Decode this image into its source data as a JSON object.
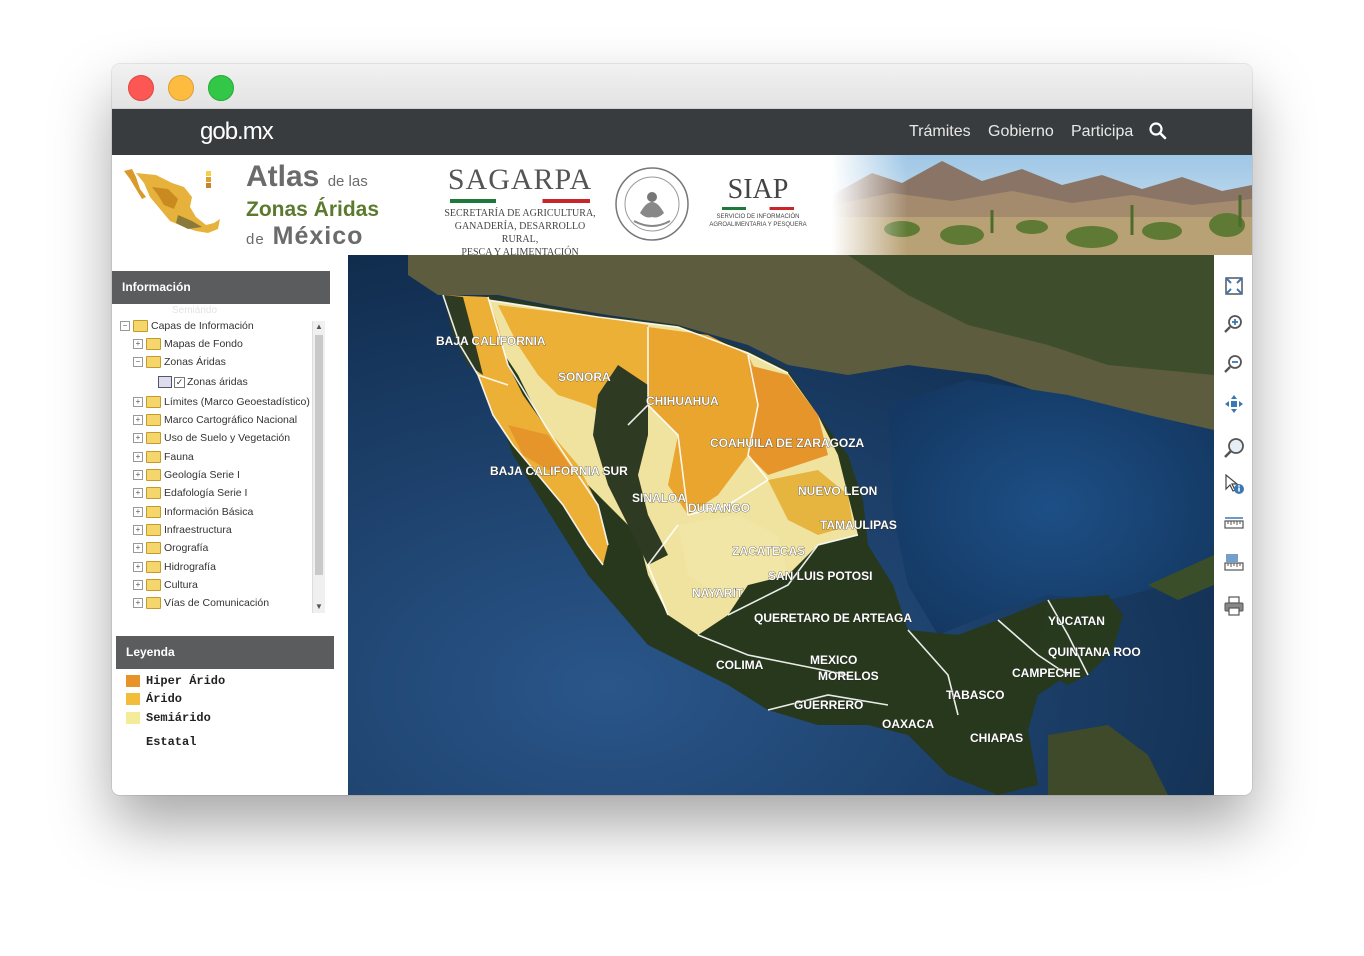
{
  "window": {
    "controls": [
      "close",
      "minimize",
      "zoom"
    ]
  },
  "gob_nav": {
    "logo": "gob.mx",
    "links": [
      "Trámites",
      "Gobierno",
      "Participa"
    ],
    "search_icon": "search-icon"
  },
  "header": {
    "atlas_title": {
      "l1_big": "Atlas",
      "l1_small": "de las",
      "l2": "Zonas Áridas",
      "l3_small": "de",
      "l3_big": "México"
    },
    "sagarpa": {
      "name": "SAGARPA",
      "subtitle": [
        "SECRETARÍA DE AGRICULTURA,",
        "GANADERÍA, DESARROLLO RURAL,",
        "PESCA Y ALIMENTACIÓN"
      ]
    },
    "siap": {
      "name": "SIAP",
      "subtitle": [
        "SERVICIO DE INFORMACIÓN",
        "AGROALIMENTARIA Y PESQUERA"
      ]
    }
  },
  "info_panel": {
    "title": "Información",
    "ghost_text": "Semiárido",
    "tree": [
      {
        "label": "Capas de Información",
        "level": 0,
        "expanded": true
      },
      {
        "label": "Mapas de Fondo",
        "level": 1,
        "expanded": false
      },
      {
        "label": "Zonas Áridas",
        "level": 1,
        "expanded": true
      },
      {
        "label": "Zonas áridas",
        "level": 2,
        "checked": true
      },
      {
        "label": "Límites (Marco Geoestadístico)",
        "level": 1
      },
      {
        "label": "Marco Cartográfico Nacional",
        "level": 1
      },
      {
        "label": "Uso de Suelo y Vegetación",
        "level": 1
      },
      {
        "label": "Fauna",
        "level": 1
      },
      {
        "label": "Geología Serie I",
        "level": 1
      },
      {
        "label": "Edafología Serie I",
        "level": 1
      },
      {
        "label": "Información Básica",
        "level": 1
      },
      {
        "label": "Infraestructura",
        "level": 1
      },
      {
        "label": "Orografía",
        "level": 1
      },
      {
        "label": "Hidrografía",
        "level": 1
      },
      {
        "label": "Cultura",
        "level": 1
      },
      {
        "label": "Vías de Comunicación",
        "level": 1
      }
    ]
  },
  "legend": {
    "title": "Leyenda",
    "items": [
      {
        "label": "Hiper Árido",
        "color": "#e8922a"
      },
      {
        "label": "Árido",
        "color": "#f2bd3a"
      },
      {
        "label": "Semiárido",
        "color": "#f5ec9a"
      },
      {
        "label": "Estatal",
        "color": "#ffffff"
      }
    ]
  },
  "map": {
    "state_labels": [
      "BAJA CALIFORNIA",
      "SONORA",
      "CHIHUAHUA",
      "COAHUILA DE ZARAGOZA",
      "BAJA CALIFORNIA SUR",
      "SINALOA",
      "DURANGO",
      "NUEVO LEON",
      "TAMAULIPAS",
      "ZACATECAS",
      "SAN LUIS POTOSI",
      "NAYARIT",
      "QUERETARO DE ARTEAGA",
      "YUCATAN",
      "QUINTANA ROO",
      "CAMPECHE",
      "COLIMA",
      "MEXICO",
      "MORELOS",
      "TABASCO",
      "GUERRERO",
      "OAXACA",
      "CHIAPAS"
    ],
    "colors": {
      "ocean": "#1d3f66",
      "land": "#5c5a3e",
      "hiper": "#e8922a",
      "arido": "#f2bd3a",
      "semi": "#f2e7a2",
      "humid": "#25361c"
    }
  },
  "tools": [
    "full-extent-icon",
    "zoom-in-icon",
    "zoom-out-icon",
    "pan-icon",
    "magnifier-icon",
    "identify-icon",
    "measure-icon",
    "measure-area-icon",
    "print-icon"
  ]
}
